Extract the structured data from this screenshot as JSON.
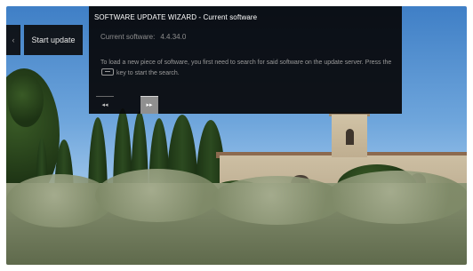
{
  "side_menu": {
    "back_glyph": "‹",
    "start_update_label": "Start update"
  },
  "wizard": {
    "title": "SOFTWARE UPDATE WIZARD - Current software",
    "current_software_label": "Current software:",
    "current_software_value": "4.4.34.0",
    "instructions_part1": "To load a new piece of software, you first need to search for said software on the update server. Press the ",
    "instructions_part2": " key to start the search.",
    "nav_buttons": [
      {
        "label": "◂◂",
        "selected": false
      },
      {
        "label": "▸▸",
        "selected": true
      }
    ]
  },
  "colors": {
    "overlay": "#08080a",
    "selected_button": "#8f8f8f",
    "title_text": "#ffffff",
    "body_text": "#9a9a9a"
  },
  "icons": {
    "key": "ok-key-icon"
  }
}
